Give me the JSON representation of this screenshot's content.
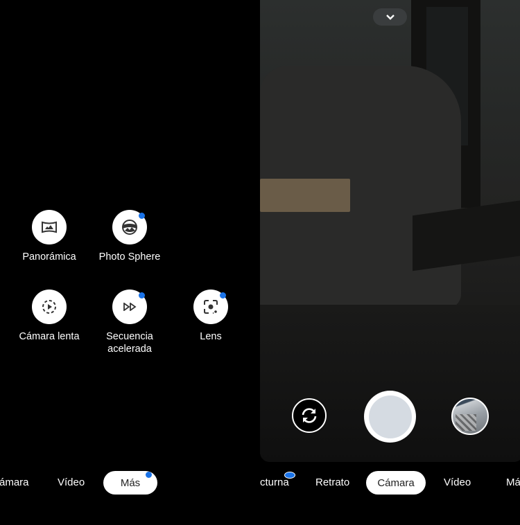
{
  "more_panel": {
    "modes": [
      {
        "label": "Panorámica",
        "icon": "panorama-icon",
        "new": false
      },
      {
        "label": "Photo Sphere",
        "icon": "photo-sphere-icon",
        "new": true
      },
      {
        "label": "Cámara lenta",
        "icon": "slow-motion-icon",
        "new": false
      },
      {
        "label": "Secuencia acelerada",
        "label_line1": "Secuencia",
        "label_line2": "acelerada",
        "icon": "time-lapse-icon",
        "new": true
      },
      {
        "label": "Lens",
        "icon": "lens-icon",
        "new": true
      }
    ],
    "tabs": [
      {
        "label": "ámara"
      },
      {
        "label": "Vídeo"
      },
      {
        "label": "Más",
        "selected": true,
        "new": true
      }
    ]
  },
  "camera": {
    "tabs": [
      {
        "label": "cturna",
        "new": true
      },
      {
        "label": "Retrato"
      },
      {
        "label": "Cámara",
        "selected": true
      },
      {
        "label": "Vídeo"
      },
      {
        "label": "Má"
      }
    ],
    "controls": {
      "collapse_icon": "chevron-down-icon",
      "switch_icon": "switch-camera-icon",
      "shutter_color": "#d5dbe2",
      "thumbnail": "gallery-thumbnail"
    }
  },
  "colors": {
    "accent_dot": "#1a73e8",
    "background": "#000000"
  }
}
